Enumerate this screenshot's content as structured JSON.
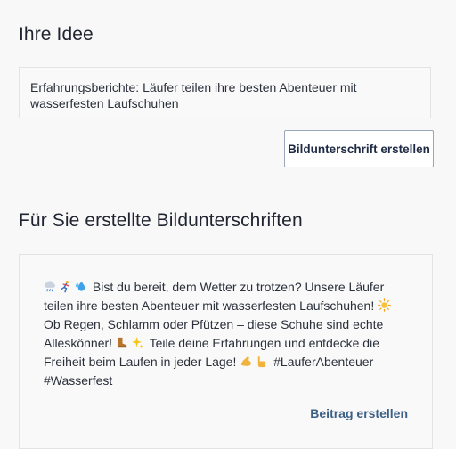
{
  "idea_section": {
    "title": "Ihre Idee",
    "idea_text": "Erfahrungsberichte: Läufer teilen ihre besten Abenteuer mit wasserfesten Laufschuhen",
    "generate_button_label": "Bildunterschrift erstellen"
  },
  "captions_section": {
    "title": "Für Sie erstellte Bildunterschriften",
    "captions": [
      {
        "segment_1": "Bist du bereit, dem Wetter zu trotzen? Unsere Läufer teilen ihre besten Abenteuer mit wasserfesten Laufschuhen!",
        "segment_2": "Ob Regen, Schlamm oder Pfützen – diese Schuhe sind echte Alleskönner!",
        "segment_3": "Teile deine Erfahrungen und entdecke die Freiheit beim Laufen in jeder Lage!",
        "segment_4": "#LauferAbenteuer #Wasserfest",
        "emojis": [
          "cloud-rain-icon",
          "runner-icon",
          "splash-icon",
          "sun-icon",
          "boot-icon",
          "sparkles-icon",
          "flexed-biceps-icon",
          "pointing-icon"
        ],
        "post_button_label": "Beitrag erstellen"
      }
    ]
  },
  "colors": {
    "background": "#f8f8f8",
    "card_border": "#e3e3e3",
    "button_border": "#9aa6bb",
    "link": "#3c5f86",
    "text": "#1f2430"
  }
}
